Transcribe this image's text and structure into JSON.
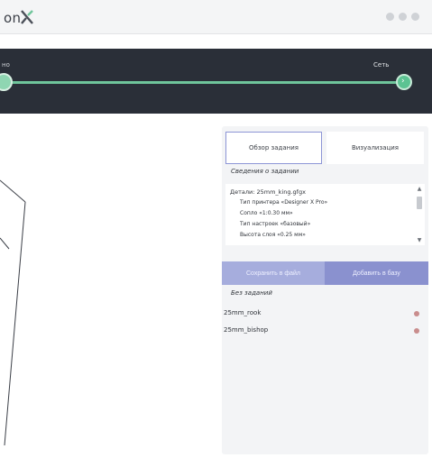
{
  "app": {
    "brand": "on"
  },
  "stepper": {
    "left_label": "но",
    "right_label": "Сеть"
  },
  "panel": {
    "tabs": [
      "Обзор задания",
      "Визуализация"
    ],
    "task_info_title": "Сведения о задании",
    "details": {
      "header": "Детали: 25mm_king.gfgx",
      "lines": [
        "Тип принтера «Designer X Pro»",
        "Сопло «1:0.30 мм»",
        "Тип настроек «базовый»",
        "Высота слоя «0.25 мм»"
      ]
    },
    "save_button": "Сохранить в файл",
    "add_button": "Добавить в базу",
    "no_tasks_label": "Без заданий",
    "files": [
      "25mm_rook",
      "25mm_bishop"
    ]
  },
  "colors": {
    "accent": "#8a91cf",
    "progress": "#6fc59b",
    "header_bg": "#2a2f38"
  }
}
